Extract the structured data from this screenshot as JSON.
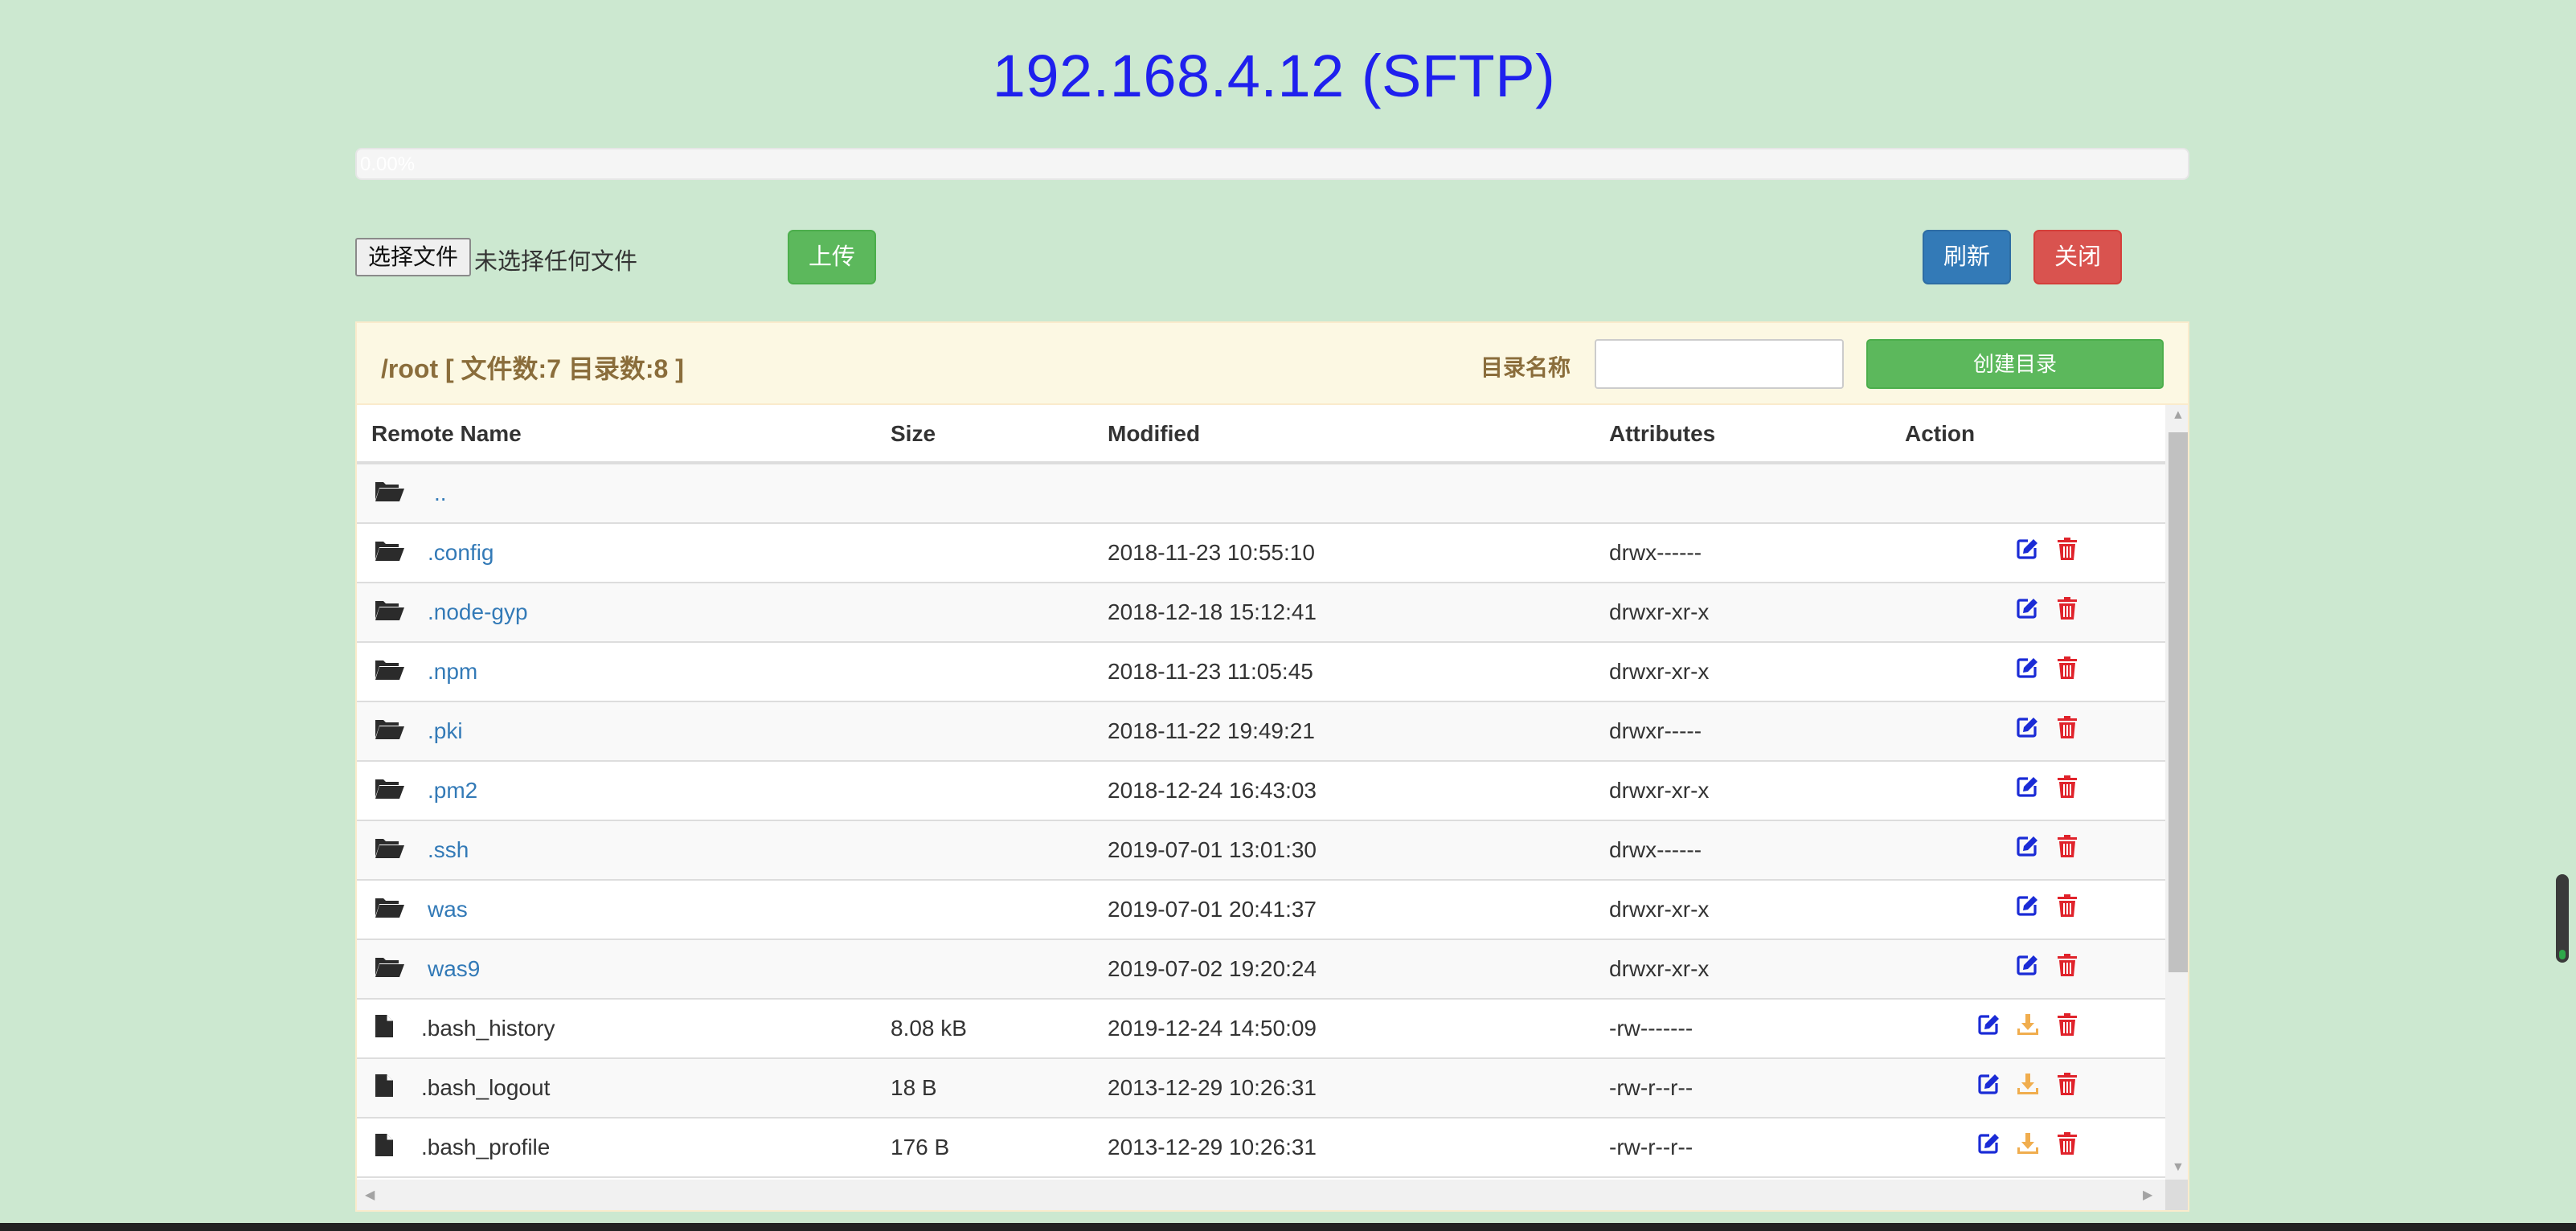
{
  "title": "192.168.4.12 (SFTP)",
  "progress": {
    "percent": 0,
    "label": "0.00%"
  },
  "upload": {
    "choose_label": "选择文件",
    "none_label": "未选择任何文件",
    "upload_label": "上传",
    "refresh_label": "刷新",
    "close_label": "关闭"
  },
  "panel": {
    "path": "/root [ 文件数:7 目录数:8 ]",
    "dir_label": "目录名称",
    "dir_input_value": "",
    "mkdir_label": "创建目录"
  },
  "table": {
    "headers": [
      "Remote Name",
      "Size",
      "Modified",
      "Attributes",
      "Action"
    ],
    "rows": [
      {
        "kind": "up",
        "name": "..",
        "size": "",
        "modified": "",
        "attributes": "",
        "actions": []
      },
      {
        "kind": "dir",
        "name": ".config",
        "size": "",
        "modified": "2018-11-23 10:55:10",
        "attributes": "drwx------",
        "actions": [
          "edit",
          "delete"
        ]
      },
      {
        "kind": "dir",
        "name": ".node-gyp",
        "size": "",
        "modified": "2018-12-18 15:12:41",
        "attributes": "drwxr-xr-x",
        "actions": [
          "edit",
          "delete"
        ]
      },
      {
        "kind": "dir",
        "name": ".npm",
        "size": "",
        "modified": "2018-11-23 11:05:45",
        "attributes": "drwxr-xr-x",
        "actions": [
          "edit",
          "delete"
        ]
      },
      {
        "kind": "dir",
        "name": ".pki",
        "size": "",
        "modified": "2018-11-22 19:49:21",
        "attributes": "drwxr-----",
        "actions": [
          "edit",
          "delete"
        ]
      },
      {
        "kind": "dir",
        "name": ".pm2",
        "size": "",
        "modified": "2018-12-24 16:43:03",
        "attributes": "drwxr-xr-x",
        "actions": [
          "edit",
          "delete"
        ]
      },
      {
        "kind": "dir",
        "name": ".ssh",
        "size": "",
        "modified": "2019-07-01 13:01:30",
        "attributes": "drwx------",
        "actions": [
          "edit",
          "delete"
        ]
      },
      {
        "kind": "dir",
        "name": "was",
        "size": "",
        "modified": "2019-07-01 20:41:37",
        "attributes": "drwxr-xr-x",
        "actions": [
          "edit",
          "delete"
        ]
      },
      {
        "kind": "dir",
        "name": "was9",
        "size": "",
        "modified": "2019-07-02 19:20:24",
        "attributes": "drwxr-xr-x",
        "actions": [
          "edit",
          "delete"
        ]
      },
      {
        "kind": "file",
        "name": ".bash_history",
        "size": "8.08 kB",
        "modified": "2019-12-24 14:50:09",
        "attributes": "-rw-------",
        "actions": [
          "edit",
          "download",
          "delete"
        ]
      },
      {
        "kind": "file",
        "name": ".bash_logout",
        "size": "18 B",
        "modified": "2013-12-29 10:26:31",
        "attributes": "-rw-r--r--",
        "actions": [
          "edit",
          "download",
          "delete"
        ]
      },
      {
        "kind": "file",
        "name": ".bash_profile",
        "size": "176 B",
        "modified": "2013-12-29 10:26:31",
        "attributes": "-rw-r--r--",
        "actions": [
          "edit",
          "download",
          "delete"
        ]
      }
    ]
  },
  "icons": {
    "folder": "folder-open-icon",
    "file": "file-icon",
    "edit": "edit-icon",
    "download": "download-icon",
    "delete": "trash-icon"
  },
  "colors": {
    "background": "#cce8d0",
    "title": "#1f20ee",
    "success": "#5cb85c",
    "primary": "#337ab7",
    "danger": "#d9534f",
    "warning_text": "#8a6d3b",
    "edit_icon": "#1a2bd6",
    "download_icon": "#f0ad4e",
    "delete_icon": "#e0232b"
  }
}
